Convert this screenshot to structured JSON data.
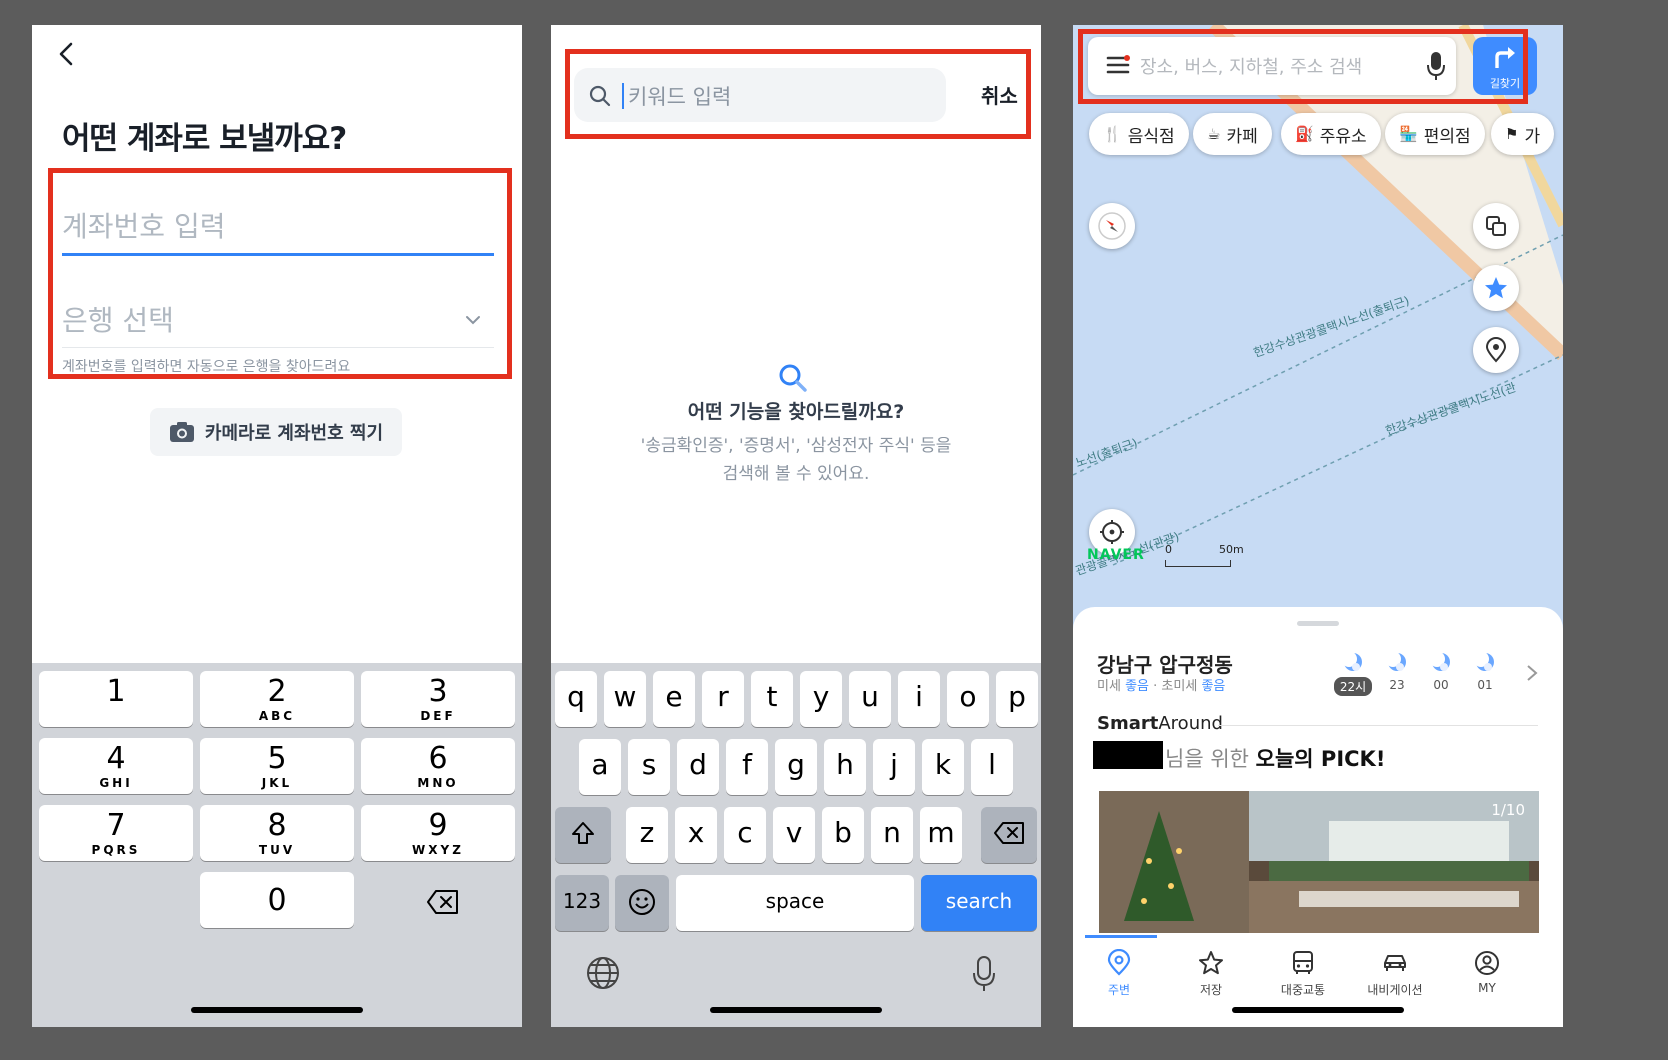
{
  "phone1": {
    "title": "어떤 계좌로 보낼까요?",
    "account_placeholder": "계좌번호 입력",
    "bank_placeholder": "은행 선택",
    "hint": "계좌번호를 입력하면 자동으로 은행을 찾아드려요",
    "camera_label": "카메라로 계좌번호 찍기",
    "keypad": [
      {
        "digit": "1",
        "letters": ""
      },
      {
        "digit": "2",
        "letters": "ABC"
      },
      {
        "digit": "3",
        "letters": "DEF"
      },
      {
        "digit": "4",
        "letters": "GHI"
      },
      {
        "digit": "5",
        "letters": "JKL"
      },
      {
        "digit": "6",
        "letters": "MNO"
      },
      {
        "digit": "7",
        "letters": "PQRS"
      },
      {
        "digit": "8",
        "letters": "TUV"
      },
      {
        "digit": "9",
        "letters": "WXYZ"
      },
      {
        "digit": "0",
        "letters": ""
      }
    ]
  },
  "phone2": {
    "search_placeholder": "키워드 입력",
    "cancel_label": "취소",
    "empty_title": "어떤 기능을 찾아드릴까요?",
    "empty_line1": "'송금확인증', '증명서', '삼성전자 주식' 등을",
    "empty_line2": "검색해 볼 수 있어요.",
    "keyboard": {
      "row1": [
        "q",
        "w",
        "e",
        "r",
        "t",
        "y",
        "u",
        "i",
        "o",
        "p"
      ],
      "row2": [
        "a",
        "s",
        "d",
        "f",
        "g",
        "h",
        "j",
        "k",
        "l"
      ],
      "row3": [
        "z",
        "x",
        "c",
        "v",
        "b",
        "n",
        "m"
      ],
      "num_label": "123",
      "space_label": "space",
      "search_label": "search"
    }
  },
  "phone3": {
    "search_placeholder": "장소, 버스, 지하철, 주소 검색",
    "route_label": "길찾기",
    "chips": [
      {
        "icon": "fork-knife-icon",
        "glyph": "🍴",
        "label": "음식점"
      },
      {
        "icon": "coffee-icon",
        "glyph": "☕",
        "label": "카페"
      },
      {
        "icon": "fuel-icon",
        "glyph": "⛽",
        "label": "주유소"
      },
      {
        "icon": "store-icon",
        "glyph": "🏪",
        "label": "편의점"
      },
      {
        "icon": "flag-icon",
        "glyph": "⚑",
        "label": "가"
      }
    ],
    "map_labels": {
      "label1": "한강수상관광콜택시노선(출퇴근)",
      "label2": "한강수상관광콜택시노선(관",
      "label3": "노선(출퇴근)",
      "label4": "관광콜택시노선(관광)"
    },
    "naver_logo": "NAVER",
    "scale_zero": "0",
    "scale_fifty": "50m",
    "location": "강남구 압구정동",
    "air_label1": "미세",
    "air_value1": "좋음",
    "air_sep": "·",
    "air_label2": "초미세",
    "air_value2": "좋음",
    "weather": [
      {
        "hour": "22시",
        "now": true
      },
      {
        "hour": "23",
        "now": false
      },
      {
        "hour": "00",
        "now": false
      },
      {
        "hour": "01",
        "now": false
      }
    ],
    "smart_bold": "Smart",
    "smart_rest": "Around",
    "pick_prefix": "님을 위한",
    "pick_bold": "오늘의 PICK!",
    "photo_counter": "1/10",
    "tabs": [
      {
        "icon": "location-pin-icon",
        "label": "주변",
        "active": true
      },
      {
        "icon": "star-icon",
        "label": "저장",
        "active": false
      },
      {
        "icon": "bus-icon",
        "label": "대중교통",
        "active": false
      },
      {
        "icon": "car-icon",
        "label": "내비게이션",
        "active": false
      },
      {
        "icon": "profile-icon",
        "label": "MY",
        "active": false
      }
    ]
  },
  "colors": {
    "highlight_box": "#e3301e",
    "toss_blue": "#3182f6",
    "naver_blue": "#3f8cff",
    "naver_green": "#03c75a",
    "map_water": "#c7dbf4"
  }
}
